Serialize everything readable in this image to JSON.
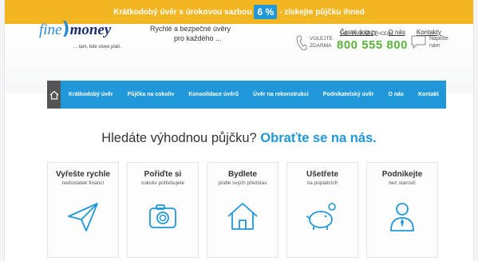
{
  "promo": {
    "text_before": "Krátkodobý úvěr s úrokovou sazbou",
    "rate": "6 %",
    "text_after": "- získejte půjčku ihned"
  },
  "toplinks": [
    "Časté dotazy",
    "O nás",
    "Kontakty"
  ],
  "logo": {
    "fine": "fine",
    "paren": ")",
    "money": "money",
    "slogan": "... tam, kde slovo platí."
  },
  "tagline": {
    "line1": "Rychlé a bezpečné úvěry",
    "line2": "pro každého ..."
  },
  "contact": {
    "label_line1": "VOLEJTE",
    "label_line2": "ZDARMA",
    "hours": "PO - PÁ 9 AŽ 17 HODIN",
    "phone": "800 555 800",
    "chat_line1": "Napište",
    "chat_line2": "nám"
  },
  "nav": {
    "home_icon": "home-icon",
    "items": [
      "Krátkodobý úvěr",
      "Půjčka na cokoliv",
      "Konsolidace úvěrů",
      "Úvěr na rekonstrukci",
      "Podnikatelský úvěr",
      "O nás",
      "Kontakt"
    ]
  },
  "headline": {
    "text": "Hledáte výhodnou půjčku?",
    "accent": "Obraťte se na nás."
  },
  "cards": [
    {
      "title": "Vyřešte rychle",
      "sub": "nedostatek financí",
      "icon": "paper-plane-icon"
    },
    {
      "title": "Pořiďte si",
      "sub": "cokoliv potřebujete",
      "icon": "camera-icon"
    },
    {
      "title": "Bydlete",
      "sub": "podle svých představ",
      "icon": "house-icon"
    },
    {
      "title": "Ušetřete",
      "sub": "na poplatcích",
      "icon": "piggy-bank-icon"
    },
    {
      "title": "Podnikejte",
      "sub": "bez starostí",
      "icon": "businessman-icon"
    }
  ],
  "colors": {
    "accent": "#1f97d8",
    "promo": "#f3b623",
    "phone": "#5cb43e",
    "brand_dark": "#1a2f6e"
  }
}
